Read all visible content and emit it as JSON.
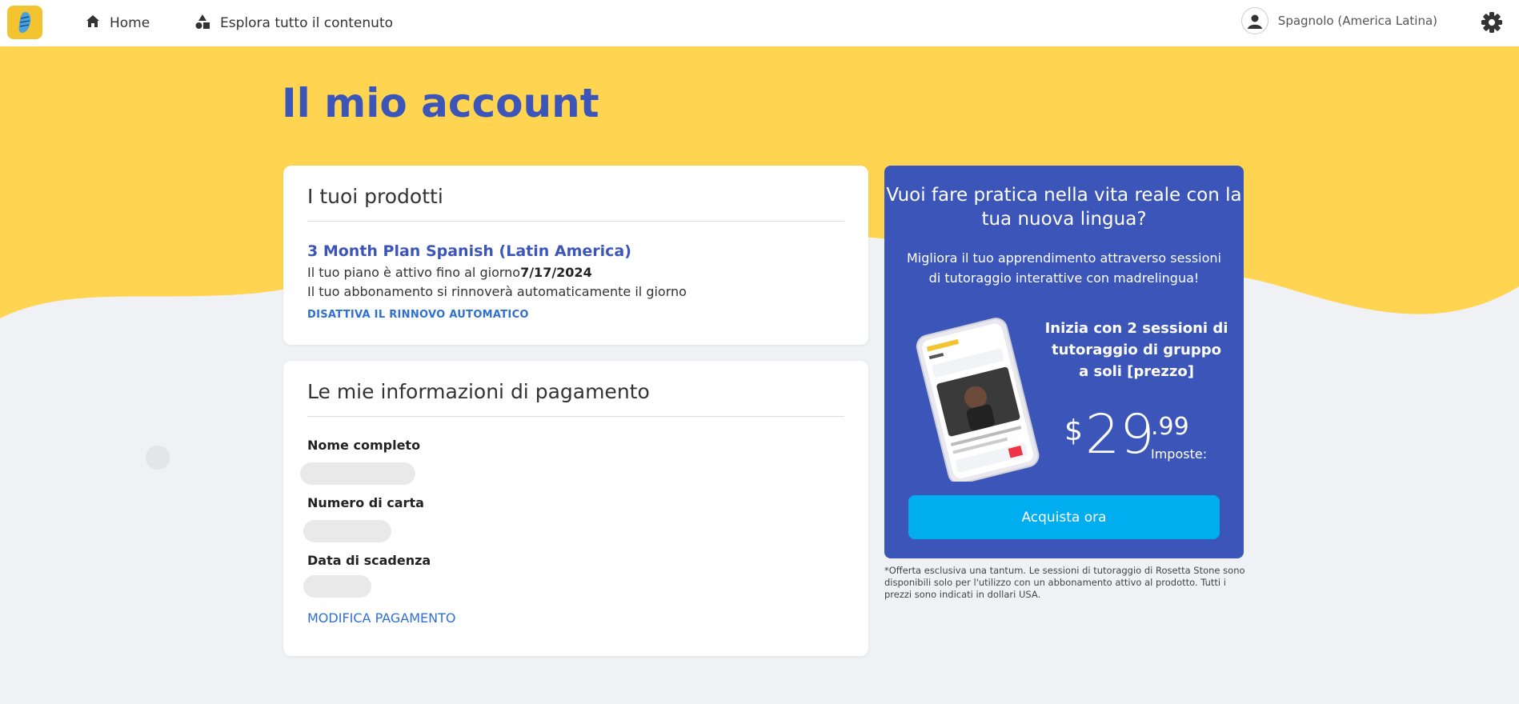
{
  "nav": {
    "home_label": "Home",
    "explore_label": "Esplora tutto il contenuto",
    "language_label": "Spagnolo (America Latina)"
  },
  "page": {
    "title": "Il mio account"
  },
  "products": {
    "title": "I tuoi prodotti",
    "plan_name": "3 Month Plan Spanish (Latin America)",
    "active_prefix": "Il tuo piano è attivo fino al giorno",
    "active_date": "7/17/2024",
    "renew_text": "Il tuo abbonamento si rinnoverà automaticamente il giorno",
    "disable_label": "DISATTIVA IL RINNOVO AUTOMATICO"
  },
  "payment": {
    "title": "Le mie informazioni di pagamento",
    "name_label": "Nome completo",
    "card_label": "Numero di carta",
    "expiry_label": "Data di scadenza",
    "edit_label": "MODIFICA PAGAMENTO"
  },
  "promo": {
    "heading": "Vuoi fare pratica nella vita reale con la tua nuova lingua?",
    "subtext": "Migliora il tuo apprendimento attraverso sessioni di tutoraggio interattive con madrelingua!",
    "offer": "Inizia con 2 sessioni di tutoraggio di gruppo a soli [prezzo]",
    "price_symbol": "$",
    "price_int": "29",
    "price_dec": ".99",
    "price_tax": "Imposte:",
    "buy_label": "Acquista ora",
    "disclaimer": "*Offerta esclusiva una tantum. Le sessioni di tutoraggio di Rosetta Stone sono disponibili solo per l'utilizzo con un abbonamento attivo al prodotto. Tutti i prezzi sono indicati in dollari USA."
  },
  "colors": {
    "brand_yellow": "#ffd451",
    "brand_blue": "#3c55b8",
    "button_cyan": "#00aeef",
    "link_blue": "#2f6fd1"
  },
  "icons": [
    "app-logo-icon",
    "home-icon",
    "shapes-icon",
    "user-avatar-icon",
    "gear-icon"
  ]
}
